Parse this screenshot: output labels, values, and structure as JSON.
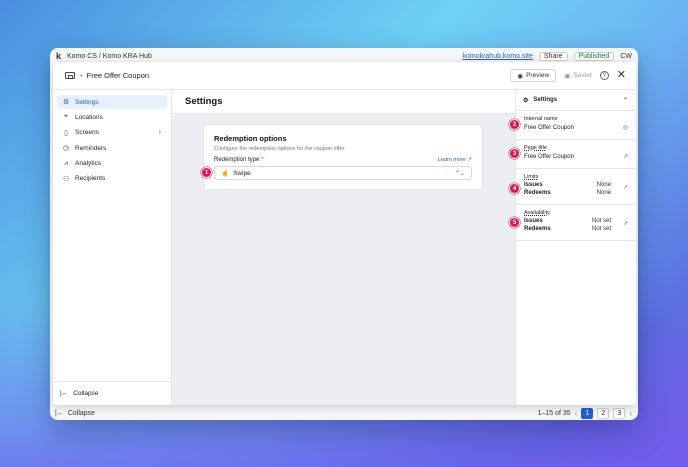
{
  "background_app": {
    "breadcrumb": "Komo CS / Komo KRA Hub",
    "link": "komokrahub.komo.site",
    "share_label": "Share",
    "status_label": "Published",
    "avatar": "CW",
    "collapse_label": "Collapse",
    "pagination": {
      "range": "1–15 of 35",
      "pages": [
        "1",
        "2",
        "3"
      ],
      "current": "1"
    }
  },
  "modal": {
    "breadcrumb_sep": "•",
    "title": "Free Offer Coupon",
    "preview_label": "Preview",
    "saved_label": "Saved",
    "help_glyph": "?",
    "close_glyph": "✕"
  },
  "sidebar": {
    "items": [
      {
        "label": "Settings",
        "icon": "gear-icon",
        "glyph": "⚙"
      },
      {
        "label": "Locations",
        "icon": "map-pin-icon",
        "glyph": "⌖"
      },
      {
        "label": "Screens",
        "icon": "phone-icon",
        "glyph": "▯"
      },
      {
        "label": "Reminders",
        "icon": "clock-icon",
        "glyph": "◷"
      },
      {
        "label": "Analytics",
        "icon": "chart-icon",
        "glyph": "⩘"
      },
      {
        "label": "Recipients",
        "icon": "users-icon",
        "glyph": "⚇"
      }
    ],
    "active": "Settings",
    "collapse_label": "Collapse",
    "collapse_glyph": "|←"
  },
  "content": {
    "title": "Settings",
    "card": {
      "title": "Redemption options",
      "description": "Configure the redemption options for the coupon offer.",
      "field_label": "Redemption type",
      "required_mark": "*",
      "learn_more": "Learn more ↗",
      "selected_value": "Swipe",
      "select_glyph": "☝"
    }
  },
  "right_panel": {
    "header": "Settings",
    "internal_name": {
      "label": "Internal name",
      "value": "Free Offer Coupon"
    },
    "page_title": {
      "label": "Page title",
      "value": "Free Offer Coupon"
    },
    "limits": {
      "label": "Limits",
      "rows": [
        {
          "k": "Issues",
          "v": "None"
        },
        {
          "k": "Redeems",
          "v": "None"
        }
      ]
    },
    "availability": {
      "label": "Availability",
      "rows": [
        {
          "k": "Issues",
          "v": "Not set"
        },
        {
          "k": "Redeems",
          "v": "Not set"
        }
      ]
    }
  },
  "badges": [
    "1",
    "2",
    "3",
    "4",
    "5"
  ],
  "colors": {
    "accent": "#1f5fd6",
    "badge": "#e2124f",
    "active_bg": "#e8effd"
  }
}
